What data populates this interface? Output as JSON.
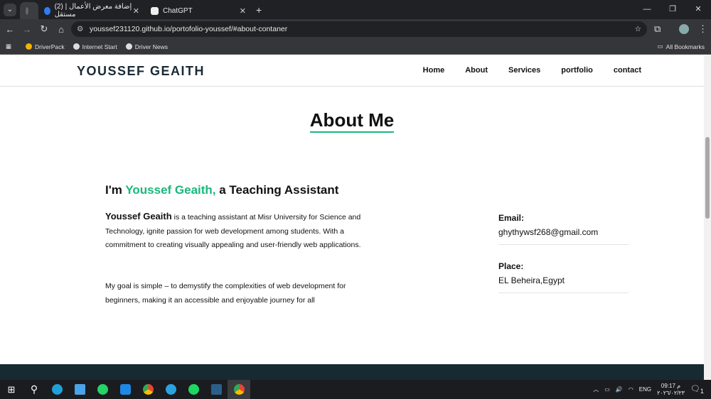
{
  "browser": {
    "tabs": [
      {
        "label": "(2) إضافة معرض الأعمال | مستقل"
      },
      {
        "label": "ChatGPT"
      }
    ],
    "new_tab": "+",
    "url": "youssef231120.github.io/portofolio-youssef/#about-contaner",
    "bookmarks": [
      {
        "label": "DriverPack"
      },
      {
        "label": "Internet Start"
      },
      {
        "label": "Driver News"
      }
    ],
    "all_bookmarks": "All Bookmarks"
  },
  "site": {
    "logo": "YOUSSEF GEAITH",
    "nav": [
      {
        "label": "Home"
      },
      {
        "label": "About"
      },
      {
        "label": "Services"
      },
      {
        "label": "portfolio"
      },
      {
        "label": "contact"
      }
    ],
    "section_title": "About Me",
    "intro": {
      "prefix": "I'm ",
      "name": "Youssef Geaith,",
      "suffix": " a Teaching Assistant"
    },
    "para1_name": "Youssef Geaith",
    "para1": " is a teaching assistant at Misr University for Science and Technology, ignite passion for web development among students. With a commitment to creating visually appealing and user-friendly web applications.",
    "para2": "My goal is simple – to demystify the complexities of web development for beginners, making it an accessible and enjoyable journey for all",
    "info": [
      {
        "label": "Email:",
        "value": "ghythywsf268@gmail.com"
      },
      {
        "label": "Place:",
        "value": "EL Beheira,Egypt"
      }
    ],
    "accent": "#1ab77b"
  },
  "taskbar": {
    "lang": "ENG",
    "time": "09:17 م",
    "date": "٢٠٢٦/٠٢/٢٣",
    "notif": "1"
  }
}
